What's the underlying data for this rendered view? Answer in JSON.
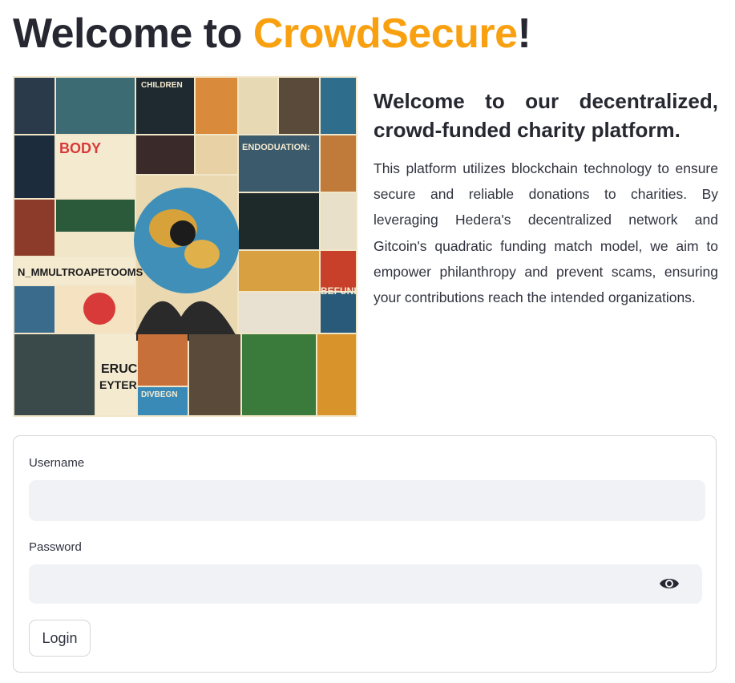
{
  "header": {
    "title_prefix": "Welcome to ",
    "brand": "CrowdSecure",
    "title_suffix": "!",
    "brand_color": "#f9a010"
  },
  "hero_image": {
    "poster_texts": [
      "CHILDREN",
      "BODY",
      "ENDODUATION:",
      "BEFUNI",
      "ERUC",
      "EYTER",
      "DIVBEGN"
    ]
  },
  "intro": {
    "heading": "Welcome to our decentralized, crowd-funded charity platform.",
    "body": "This platform utilizes blockchain technology to ensure secure and reliable donations to charities. By leveraging Hedera's decentralized network and Gitcoin's quadratic funding match model, we aim to empower philanthropy and prevent scams, ensuring your contributions reach the intended organizations."
  },
  "login_form": {
    "username_label": "Username",
    "username_value": "",
    "password_label": "Password",
    "password_value": "",
    "password_toggle_icon": "eye-icon",
    "login_button_label": "Login"
  }
}
